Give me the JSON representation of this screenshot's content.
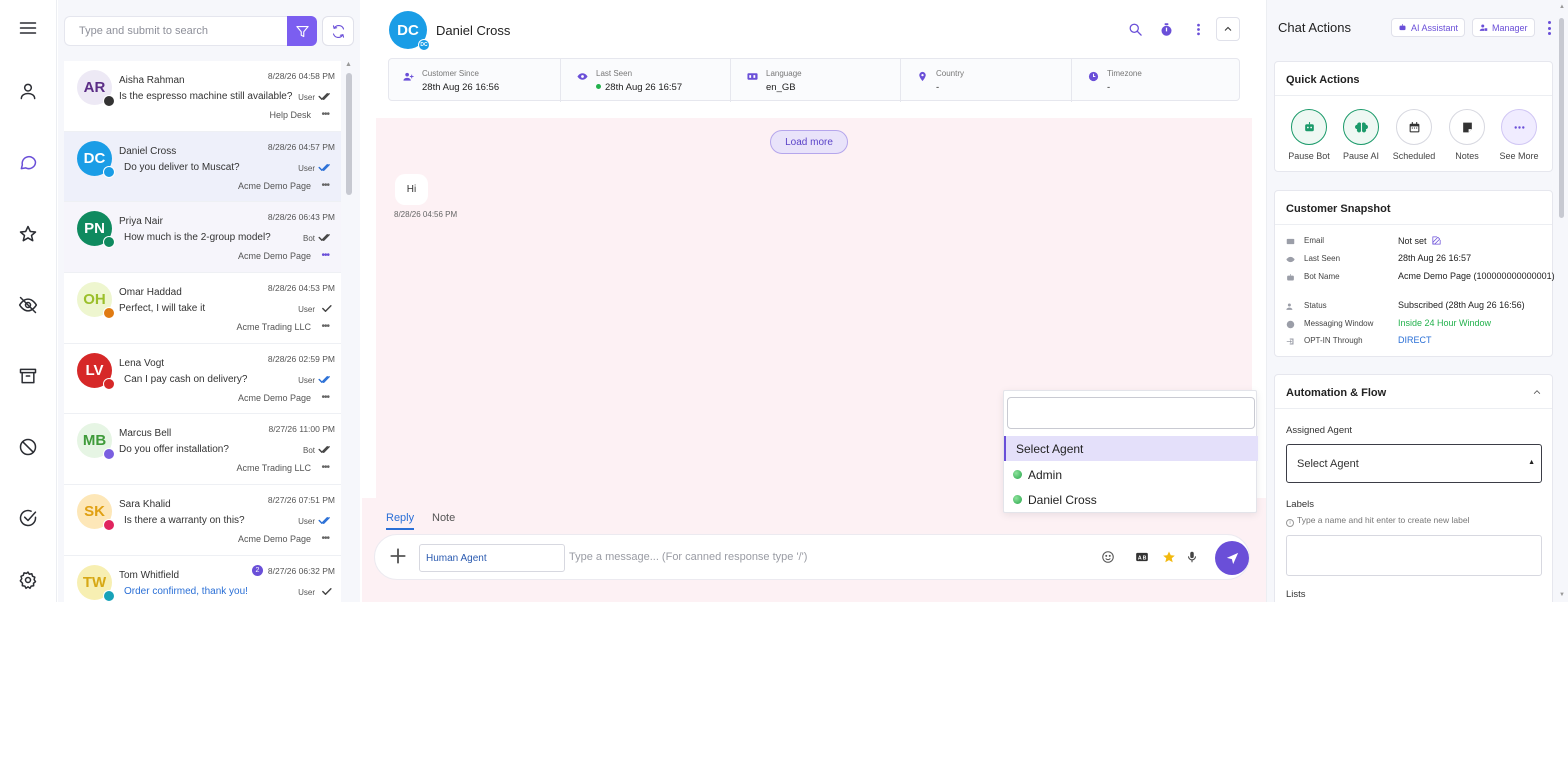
{
  "search": {
    "placeholder": "Type and submit to search"
  },
  "conversations": [
    {
      "initials": "AR",
      "name": "Aisha Rahman",
      "time": "8/28/26 04:58 PM",
      "message": "Is the espresso machine still available?",
      "sender": "User",
      "page": "Help Desk",
      "avatar_bg": "#ede9f5",
      "avatar_fg": "#5b2d86",
      "badge_bg": "#333333",
      "ticks": "double-grey"
    },
    {
      "initials": "DC",
      "name": "Daniel Cross",
      "time": "8/28/26 04:57 PM",
      "message": "Do you deliver to Muscat?",
      "sender": "User",
      "page": "Acme Demo Page",
      "avatar_bg": "#1a9de6",
      "avatar_fg": "#ffffff",
      "badge_bg": "#1a9de6",
      "ticks": "double-blue"
    },
    {
      "initials": "PN",
      "name": "Priya Nair",
      "time": "8/28/26 06:43 PM",
      "message": "How much is the 2-group model?",
      "sender": "Bot",
      "page": "Acme Demo Page",
      "avatar_bg": "#0f8a5f",
      "avatar_fg": "#ffffff",
      "badge_bg": "#0f8a5f",
      "ticks": "double-grey"
    },
    {
      "initials": "OH",
      "name": "Omar Haddad",
      "time": "8/28/26 04:53 PM",
      "message": "Perfect, I will take it",
      "sender": "User",
      "page": "Acme Trading LLC",
      "avatar_bg": "#eef6cf",
      "avatar_fg": "#9bbf2a",
      "badge_bg": "#e07b12",
      "ticks": "single-grey"
    },
    {
      "initials": "LV",
      "name": "Lena Vogt",
      "time": "8/28/26 02:59 PM",
      "message": "Can I pay cash on delivery?",
      "sender": "User",
      "page": "Acme Demo Page",
      "avatar_bg": "#d62828",
      "avatar_fg": "#ffffff",
      "badge_bg": "#d62828",
      "ticks": "double-blue"
    },
    {
      "initials": "MB",
      "name": "Marcus Bell",
      "time": "8/27/26 11:00 PM",
      "message": "Do you offer installation?",
      "sender": "Bot",
      "page": "Acme Trading LLC",
      "avatar_bg": "#e6f5e4",
      "avatar_fg": "#3f9b3a",
      "badge_bg": "#7a5fe0",
      "ticks": "double-grey"
    },
    {
      "initials": "SK",
      "name": "Sara Khalid",
      "time": "8/27/26 07:51 PM",
      "message": "Is there a warranty on this?",
      "sender": "User",
      "page": "Acme Demo Page",
      "avatar_bg": "#fde7b8",
      "avatar_fg": "#e0a012",
      "badge_bg": "#e0245e",
      "ticks": "double-blue"
    },
    {
      "initials": "TW",
      "name": "Tom Whitfield",
      "time": "8/27/26 06:32 PM",
      "message": "Order confirmed, thank you!",
      "sender": "User",
      "page": "",
      "avatar_bg": "#f7efb2",
      "avatar_fg": "#d7a814",
      "badge_bg": "#17a2b8",
      "ticks": "single-grey",
      "unread": "2"
    }
  ],
  "chat": {
    "initials": "DC",
    "name": "Daniel Cross",
    "info": [
      {
        "label": "Customer Since",
        "value": "28th Aug 26 16:56",
        "icon": "user-plus-icon"
      },
      {
        "label": "Last Seen",
        "value": "28th Aug 26 16:57",
        "icon": "eye-icon"
      },
      {
        "label": "Language",
        "value": "en_GB",
        "icon": "translate-icon"
      },
      {
        "label": "Country",
        "value": "-",
        "icon": "pin-icon"
      },
      {
        "label": "Timezone",
        "value": "-",
        "icon": "clock-icon"
      }
    ],
    "load_more": "Load more",
    "message_text": "Hi",
    "message_time": "8/28/26 04:56 PM",
    "tabs": [
      "Reply",
      "Note"
    ],
    "agent_mode": "Human Agent",
    "input_placeholder": "Type a message... (For canned response type '/')"
  },
  "dropdown": {
    "options": [
      "Select Agent",
      "Admin",
      "Daniel Cross"
    ]
  },
  "right_panel": {
    "title": "Chat Actions",
    "chip_ai": "AI Assistant",
    "chip_manager": "Manager",
    "quick_actions_title": "Quick Actions",
    "quick_actions": [
      "Pause Bot",
      "Pause AI",
      "Scheduled",
      "Notes",
      "See More"
    ],
    "snapshot_title": "Customer Snapshot",
    "snapshot": [
      {
        "label": "Email",
        "value": "Not set"
      },
      {
        "label": "Last Seen",
        "value": "28th Aug 26 16:57"
      },
      {
        "label": "Bot Name",
        "value": "Acme Demo Page (100000000000001)"
      },
      {
        "label": "Status",
        "value": "Subscribed (28th Aug 26 16:56)"
      },
      {
        "label": "Messaging Window",
        "value": "Inside 24 Hour Window"
      },
      {
        "label": "OPT-IN Through",
        "value": "DIRECT"
      }
    ],
    "automation_title": "Automation & Flow",
    "assigned_agent_label": "Assigned Agent",
    "assigned_agent_value": "Select Agent",
    "labels_label": "Labels",
    "labels_hint": "Type a name and hit enter to create new label",
    "lists_label": "Lists"
  },
  "colors": {
    "accent": "#6a4fd8",
    "chat_bg": "#fdf1f4",
    "green": "#22b14c",
    "blue_link": "#2a6fd6"
  }
}
